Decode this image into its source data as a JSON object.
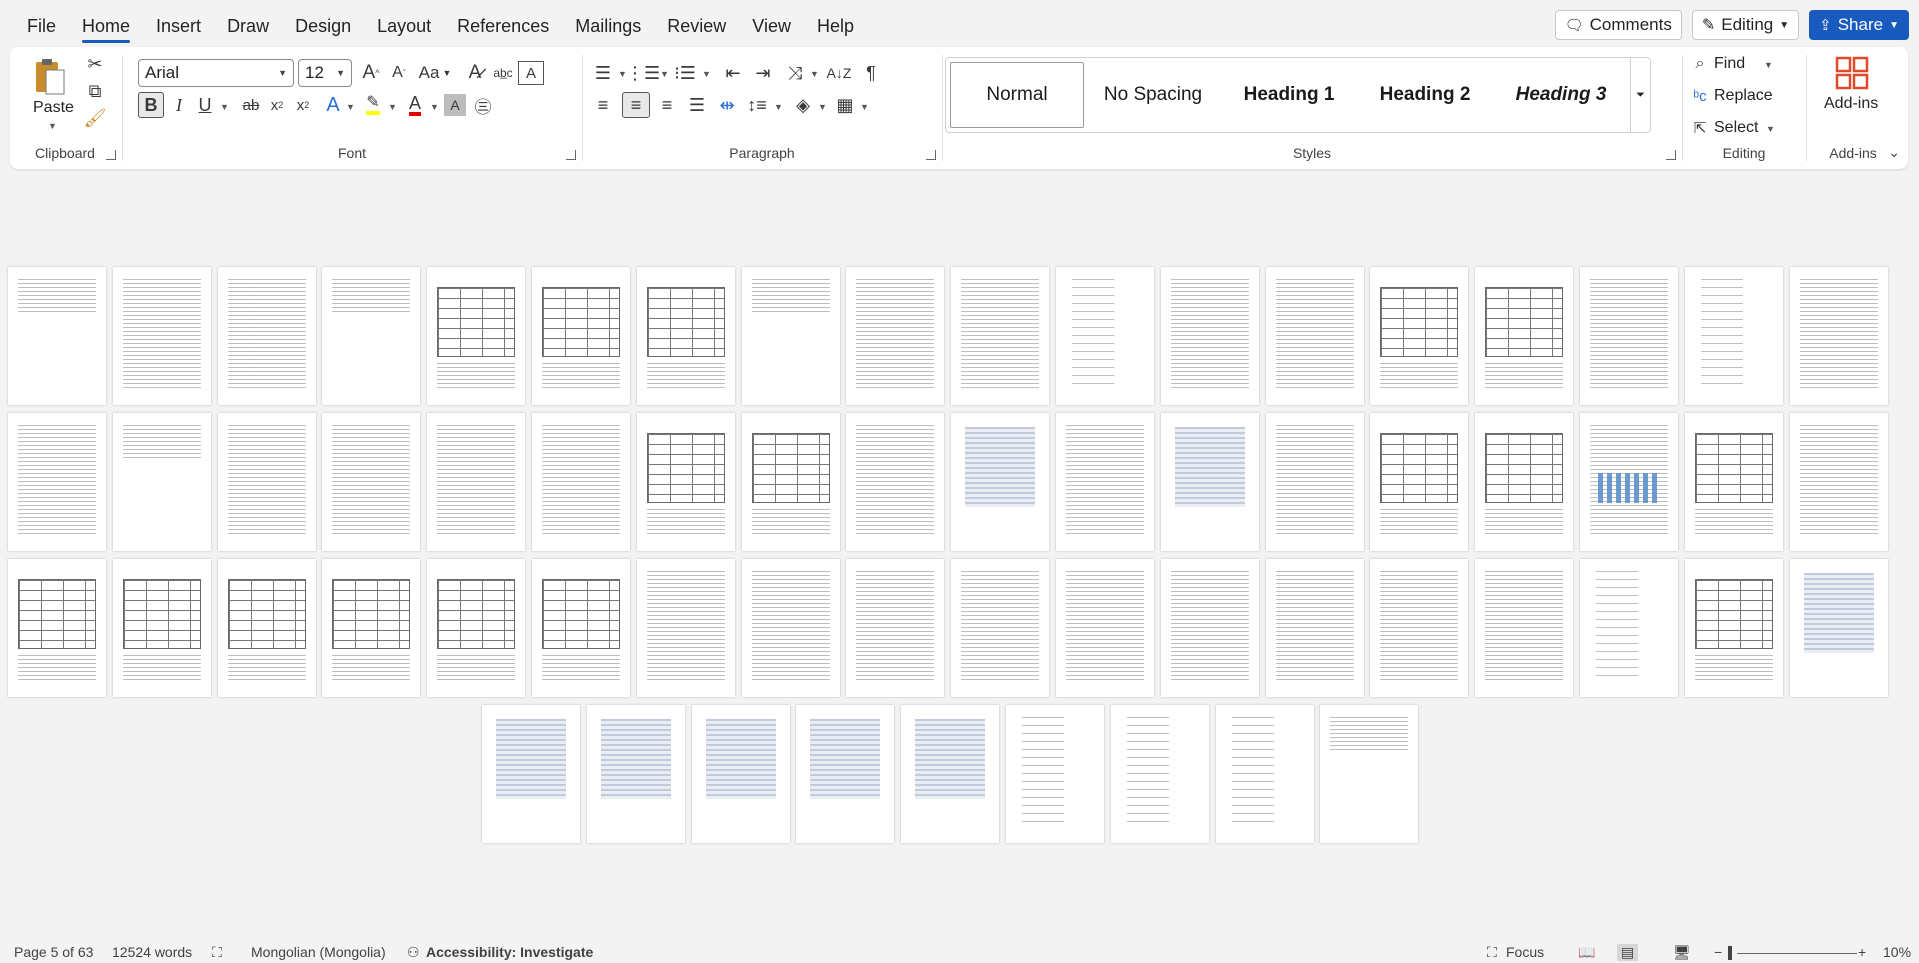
{
  "menu": {
    "items": [
      "File",
      "Home",
      "Insert",
      "Draw",
      "Design",
      "Layout",
      "References",
      "Mailings",
      "Review",
      "View",
      "Help"
    ],
    "active": "Home"
  },
  "top_right": {
    "comments_label": "Comments",
    "editing_label": "Editing",
    "share_label": "Share"
  },
  "ribbon": {
    "clipboard": {
      "paste_label": "Paste",
      "group_label": "Clipboard"
    },
    "font": {
      "font_name": "Arial",
      "font_size": "12",
      "group_label": "Font",
      "change_case": "Aa"
    },
    "paragraph": {
      "group_label": "Paragraph"
    },
    "styles": {
      "group_label": "Styles",
      "items": [
        "Normal",
        "No Spacing",
        "Heading 1",
        "Heading 2",
        "Heading 3"
      ]
    },
    "editing": {
      "find_label": "Find",
      "replace_label": "Replace",
      "select_label": "Select",
      "group_label": "Editing"
    },
    "addins": {
      "label": "Add-ins",
      "group_label": "Add-ins"
    }
  },
  "colors": {
    "accent": "#185abd",
    "highlight": "#ffff00",
    "font_color": "#e00000",
    "addins": "#e04a2a"
  },
  "status": {
    "page": "Page 5 of 63",
    "words": "12524 words",
    "language": "Mongolian (Mongolia)",
    "accessibility": "Accessibility: Investigate",
    "focus": "Focus",
    "zoom": "10%"
  }
}
